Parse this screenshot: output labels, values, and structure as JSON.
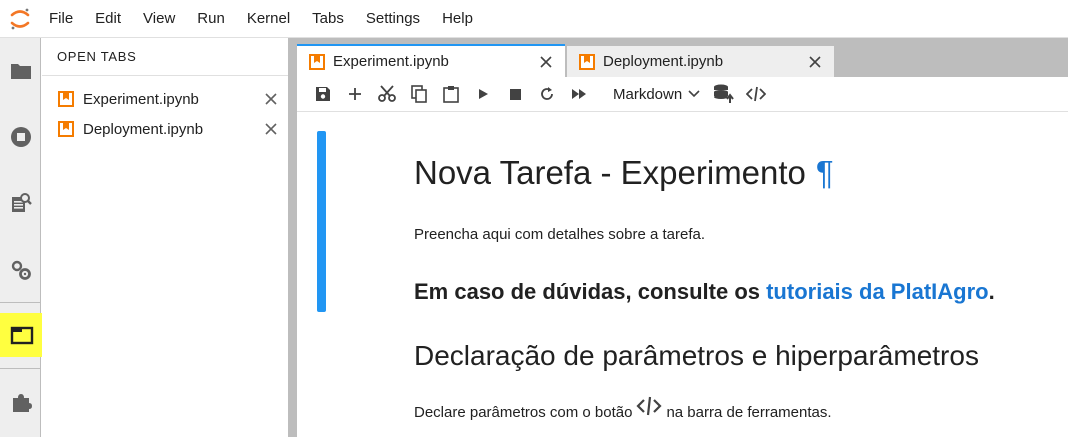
{
  "menubar": {
    "items": [
      "File",
      "Edit",
      "View",
      "Run",
      "Kernel",
      "Tabs",
      "Settings",
      "Help"
    ]
  },
  "activity_bar": {
    "icons": [
      "folder-icon",
      "stop-circle-icon",
      "property-inspector-icon",
      "gears-icon",
      "tabs-icon",
      "extension-puzzle-icon"
    ],
    "highlight_color": "#ffff40"
  },
  "sidepanel": {
    "header": "OPEN TABS",
    "items": [
      {
        "label": "Experiment.ipynb"
      },
      {
        "label": "Deployment.ipynb"
      }
    ]
  },
  "tabs": [
    {
      "label": "Experiment.ipynb",
      "active": true
    },
    {
      "label": "Deployment.ipynb",
      "active": false
    }
  ],
  "toolbar": {
    "cell_type": "Markdown"
  },
  "notebook": {
    "h1": "Nova Tarefa - Experimento",
    "h1_anchor": "¶",
    "p1": "Preencha aqui com detalhes sobre a tarefa.",
    "h3_prefix": "Em caso de dúvidas, consulte os ",
    "h3_link": "tutoriais da PlatIAgro",
    "h3_suffix": ".",
    "h2": "Declaração de parâmetros e hiperparâmetros",
    "p2_prefix": "Declare parâmetros com o botão",
    "p2_suffix": "na barra de ferramentas."
  },
  "colors": {
    "accent": "#2196f3",
    "link": "#1976d2",
    "notebook_icon": "#f57c00"
  }
}
